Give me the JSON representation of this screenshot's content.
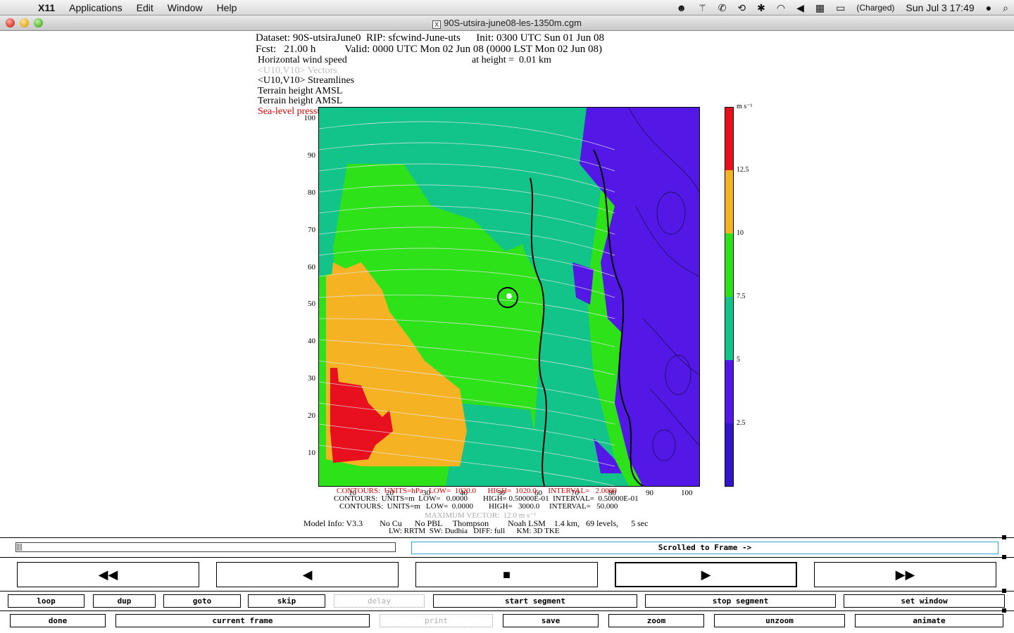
{
  "menubar": {
    "app": "X11",
    "menus": [
      "Applications",
      "Edit",
      "Window",
      "Help"
    ],
    "battery": "(Charged)",
    "clock": "Sun Jul 3  17:49"
  },
  "window": {
    "title": "90S-utsira-june08-les-1350m.cgm"
  },
  "plot": {
    "header": {
      "dataset": "Dataset: 90S-utsiraJune0  RIP: sfcwind-June-uts      Init: 0300 UTC Sun 01 Jun 08",
      "fcst": "Fcst:   21.00 h           Valid: 0000 UTC Mon 02 Jun 08 (0000 LST Mon 02 Jun 08)",
      "field": "Horizontal wind speed",
      "height": "at height =  0.01 km",
      "layer_vectors": "<U10,V10> Vectors",
      "layer_streamlines": "<U10,V10> Streamlines",
      "layer_terrain1": "Terrain height AMSL",
      "layer_terrain2": "Terrain height AMSL",
      "layer_slp": "Sea-level pressure"
    },
    "y_ticks": [
      "100",
      "90",
      "80",
      "70",
      "60",
      "50",
      "40",
      "30",
      "20",
      "10"
    ],
    "x_ticks": [
      "10",
      "20",
      "30",
      "40",
      "50",
      "60",
      "70",
      "80",
      "90",
      "100"
    ],
    "colorbar": {
      "unit": "m s⁻¹",
      "levels": [
        "12.5",
        "10",
        "7.5",
        "5",
        "2.5"
      ],
      "colors": [
        "#e8101e",
        "#f5b324",
        "#2ee21a",
        "#12c48a",
        "#5318e6",
        "#3414c8"
      ]
    },
    "footer": {
      "contours_slp": "CONTOURS:  UNITS=hPa   LOW=  1020.0      HIGH=  1020.0      INTERVAL=   2.0000",
      "contours_terrain1": "CONTOURS:  UNITS=m  LOW=   0.0000        HIGH= 0.50000E-01  INTERVAL=  0.50000E-01",
      "contours_terrain2": "CONTOURS:  UNITS=m   LOW=  0.0000        HIGH=   3000.0     INTERVAL=   50.000",
      "max_vector": "MAXIMUM VECTOR:  12.0 m s⁻¹",
      "model_info": "Model Info: V3.3        No Cu      No PBL     Thompson         Noah LSM    1.4 km,   69 levels,      5 sec",
      "model_info2": "LW: RRTM  SW: Dudhia   DIFF: full      KM: 3D TKE"
    }
  },
  "controls": {
    "scrolled_label": "Scrolled to Frame ->",
    "transport": [
      "◀◀",
      "◀",
      "■",
      "▶",
      "▶▶"
    ],
    "row1": [
      "loop",
      "dup",
      "goto",
      "skip",
      "delay",
      "start segment",
      "stop segment",
      "set window"
    ],
    "row2": [
      "done",
      "current frame",
      "print",
      "save",
      "zoom",
      "unzoom",
      "animate"
    ]
  }
}
